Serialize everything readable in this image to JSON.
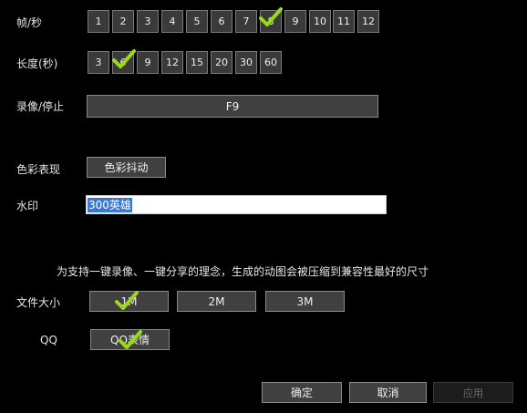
{
  "labels": {
    "fps": "帧/秒",
    "duration": "长度(秒)",
    "record": "录像/停止",
    "color": "色彩表现",
    "watermark": "水印",
    "filesize": "文件大小",
    "qq": "QQ"
  },
  "fps_options": [
    "1",
    "2",
    "3",
    "4",
    "5",
    "6",
    "7",
    "8",
    "9",
    "10",
    "11",
    "12"
  ],
  "fps_selected": "8",
  "duration_options": [
    "3",
    "6",
    "9",
    "12",
    "15",
    "20",
    "30",
    "60"
  ],
  "duration_selected": "6",
  "record_hotkey": "F9",
  "color_button": "色彩抖动",
  "watermark_value": "300英雄",
  "notice": "为支持一键录像、一键分享的理念，生成的动图会被压缩到兼容性最好的尺寸",
  "size_options": [
    "1M",
    "2M",
    "3M"
  ],
  "size_selected": "1M",
  "qq_button": "QQ表情",
  "qq_selected": true,
  "footer": {
    "ok": "确定",
    "cancel": "取消",
    "apply": "应用"
  },
  "colors": {
    "background": "#000000",
    "button": "#3a3a3a",
    "border": "#7a7a7a",
    "check": "#9bd81a",
    "selection": "#3a78d6"
  }
}
